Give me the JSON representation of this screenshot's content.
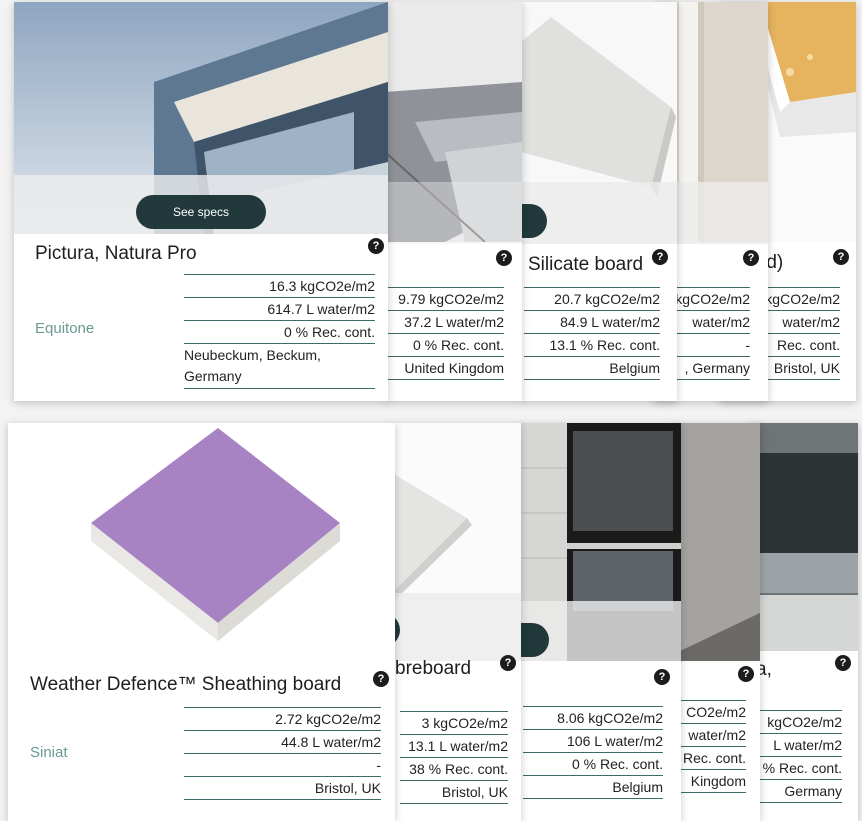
{
  "top": {
    "c5": {
      "title": "rd)",
      "rows": [
        "kgCO2e/m2",
        "water/m2",
        "Rec. cont.",
        "Bristol, UK"
      ]
    },
    "c4": {
      "rows": [
        "kgCO2e/m2",
        "water/m2",
        "-",
        ", Germany"
      ]
    },
    "c3": {
      "title": "Silicate board",
      "rows": [
        "20.7 kgCO2e/m2",
        "84.9 L water/m2",
        "13.1 % Rec. cont.",
        "Belgium"
      ]
    },
    "c2": {
      "rows": [
        "9.79 kgCO2e/m2",
        "37.2 L water/m2",
        "0 % Rec. cont.",
        "United Kingdom"
      ]
    },
    "c1": {
      "title": "Pictura, Natura Pro",
      "brand": "Equitone",
      "button": "See specs",
      "rows": [
        "16.3 kgCO2e/m2",
        "614.7 L water/m2",
        "0 % Rec. cont.",
        "Neubeckum, Beckum, Germany"
      ]
    }
  },
  "bottom": {
    "c5": {
      "title": "a,",
      "rows": [
        "kgCO2e/m2",
        "L water/m2",
        "% Rec. cont.",
        "Germany"
      ]
    },
    "c4": {
      "rows": [
        "CO2e/m2",
        "water/m2",
        "Rec. cont.",
        "Kingdom"
      ]
    },
    "c3": {
      "rows": [
        "8.06 kgCO2e/m2",
        "106 L water/m2",
        "0 % Rec. cont.",
        "Belgium"
      ]
    },
    "c2": {
      "title": "breboard",
      "rows": [
        "3 kgCO2e/m2",
        "13.1 L water/m2",
        "38 % Rec. cont.",
        "Bristol, UK"
      ]
    },
    "c1": {
      "title": "Weather Defence™ Sheathing board",
      "brand": "Siniat",
      "rows": [
        "2.72 kgCO2e/m2",
        "44.8 L water/m2",
        "-",
        "Bristol, UK"
      ]
    }
  },
  "help_symbol": "?",
  "colors": {
    "button": "#21393b",
    "brand": "#6b9a94",
    "rule": "#3d6b67"
  }
}
